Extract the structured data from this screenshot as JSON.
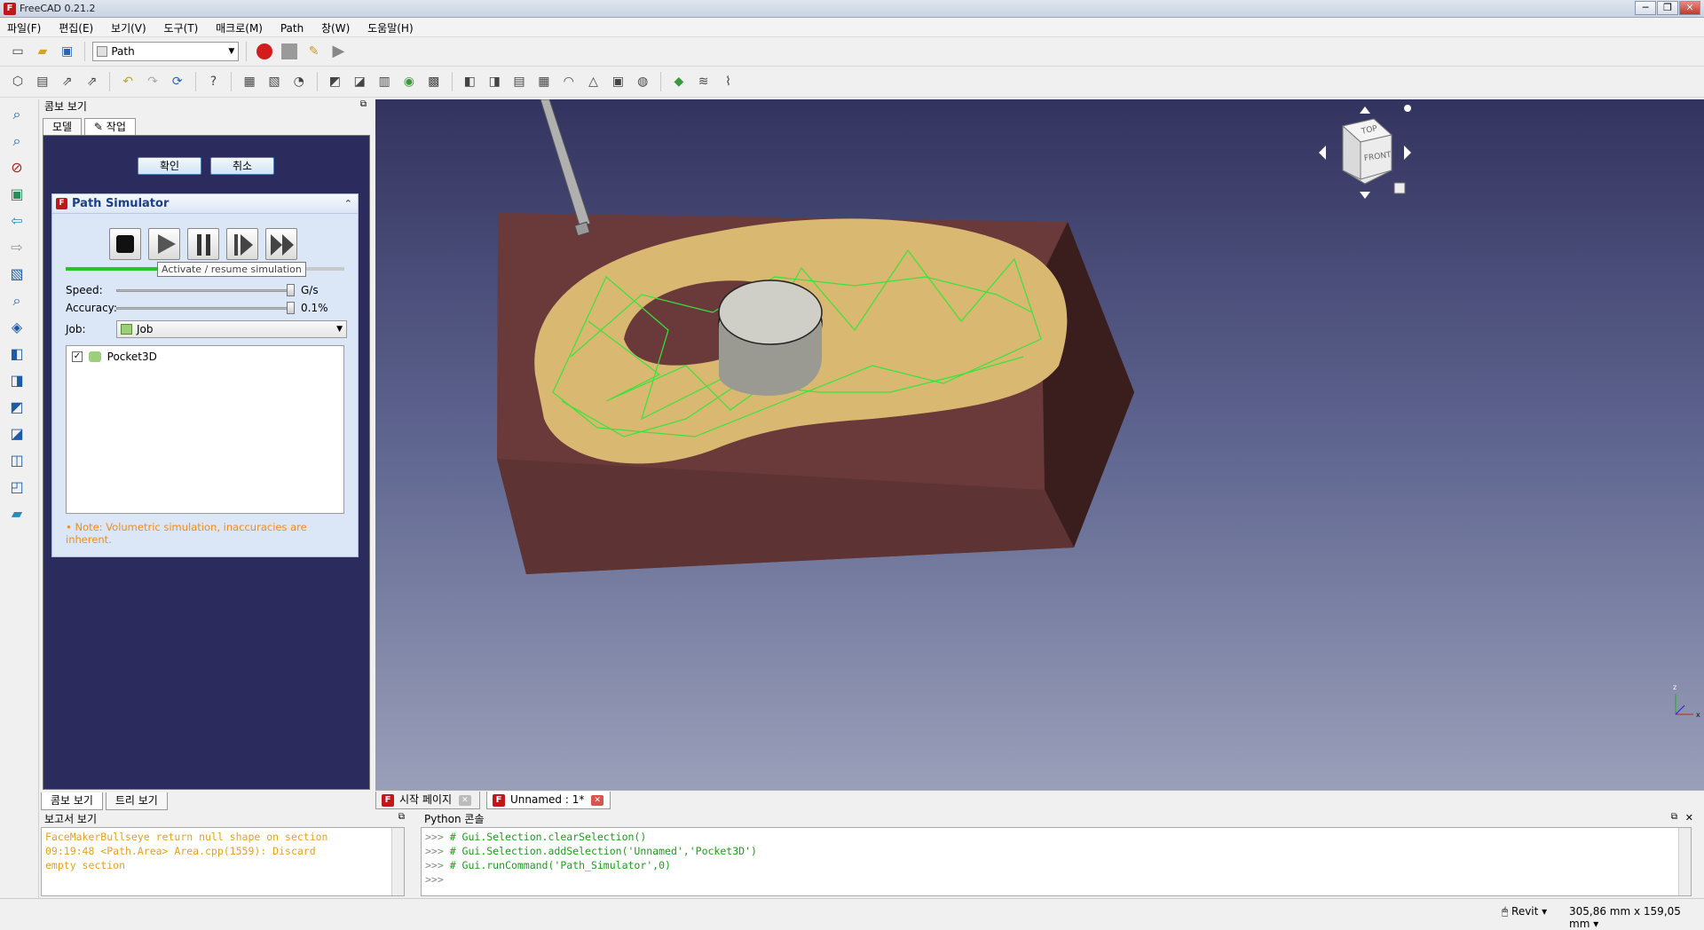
{
  "window": {
    "title": "FreeCAD 0.21.2"
  },
  "menu": [
    "파일(F)",
    "편집(E)",
    "보기(V)",
    "도구(T)",
    "매크로(M)",
    "Path",
    "창(W)",
    "도움말(H)"
  ],
  "toolbar": {
    "workbench": "Path"
  },
  "combo_view": {
    "title": "콤보 보기",
    "tabs": [
      "모델",
      "작업"
    ],
    "ok": "확인",
    "cancel": "취소",
    "bottom_tabs": [
      "콤보 보기",
      "트리 보기"
    ]
  },
  "simulator": {
    "title": "Path Simulator",
    "tooltip": "Activate / resume simulation",
    "progress": 0.58,
    "speed_label": "Speed:",
    "speed_unit": "G/s",
    "accuracy_label": "Accuracy:",
    "accuracy_value": "0.1%",
    "job_label": "Job:",
    "job_value": "Job",
    "items": [
      {
        "name": "Pocket3D",
        "checked": true
      }
    ],
    "note": "• Note: Volumetric simulation, inaccuracies are inherent."
  },
  "doc_tabs": [
    {
      "label": "시작 페이지",
      "active": false
    },
    {
      "label": "Unnamed : 1*",
      "active": true
    }
  ],
  "report": {
    "title": "보고서 보기",
    "lines": [
      "FaceMakerBullseye return null shape on section",
      "09:19:48  <Path.Area> Area.cpp(1559): Discard",
      "empty section"
    ]
  },
  "python": {
    "title": "Python 콘솔",
    "lines": [
      "# Gui.Selection.clearSelection()",
      "# Gui.Selection.addSelection('Unnamed','Pocket3D')",
      "# Gui.runCommand('Path_Simulator',0)"
    ]
  },
  "navcube": {
    "top": "TOP",
    "front": "FRONT"
  },
  "status": {
    "nav_style": "Revit",
    "dimensions": "305,86 mm x 159,05 mm"
  }
}
